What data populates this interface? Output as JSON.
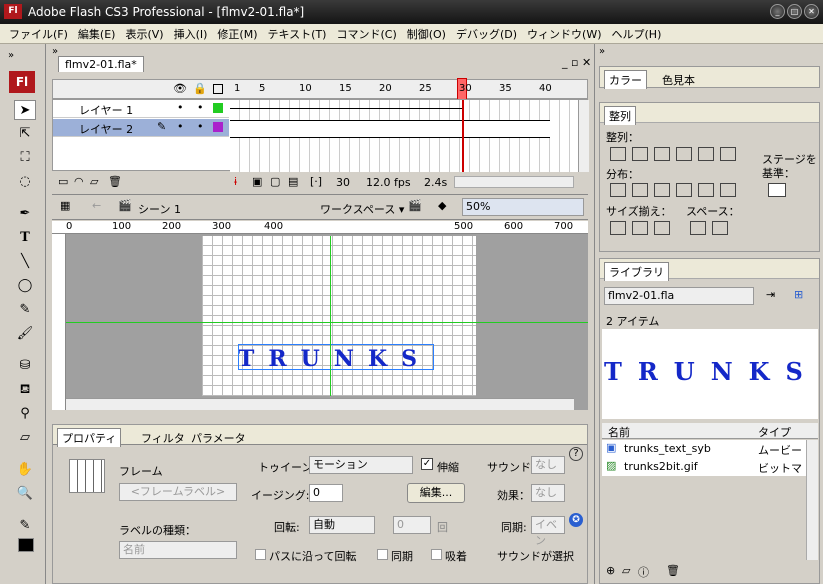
{
  "window": {
    "logo": "Fl",
    "title": "Adobe Flash CS3 Professional - [flmv2-01.fla*]",
    "min": "_",
    "max": "□",
    "close": "✕"
  },
  "menu": [
    "ファイル(F)",
    "編集(E)",
    "表示(V)",
    "挿入(I)",
    "修正(M)",
    "テキスト(T)",
    "コマンド(C)",
    "制御(O)",
    "デバッグ(D)",
    "ウィンドウ(W)",
    "ヘルプ(H)"
  ],
  "toolbox": {
    "logo": "Fl"
  },
  "document": {
    "tab": "flmv2-01.fla*"
  },
  "timeline": {
    "frame_numbers": [
      "1",
      "5",
      "10",
      "15",
      "20",
      "25",
      "30",
      "35",
      "40"
    ],
    "layers": [
      {
        "name": "レイヤー 1"
      },
      {
        "name": "レイヤー 2"
      }
    ],
    "status": {
      "frame": "30",
      "fps": "12.0 fps",
      "time": "2.4s"
    }
  },
  "editbar": {
    "scene": "シーン 1",
    "workspace": "ワークスペース ▾",
    "zoom": "50%"
  },
  "ruler": [
    "0",
    "100",
    "200",
    "300",
    "400",
    "500",
    "600",
    "700"
  ],
  "stage_text": "TRUNKS",
  "properties": {
    "tabs": [
      "プロパティ",
      "フィルタ",
      "パラメータ"
    ],
    "frame_label": "フレーム",
    "frame_label_field": "<フレームラベル>",
    "label_type_label": "ラベルの種類：",
    "label_type_value": "名前",
    "tween_label": "トゥイーン:",
    "tween_value": "モーション",
    "scale_label": "伸縮",
    "easing_label": "イージング:",
    "easing_value": "0",
    "edit_button": "編集...",
    "rotate_label": "回転:",
    "rotate_value": "自動",
    "rotate_times": "0",
    "rotate_unit": "回",
    "orient_label": "パスに沿って回転",
    "sync_label": "同期",
    "snap_label": "吸着",
    "sound_label": "サウンド:",
    "sound_value": "なし",
    "effect_label": "効果：",
    "effect_value": "なし",
    "sync_label2": "同期:",
    "sync_value": "イベン",
    "sound_note": "サウンドが選択"
  },
  "color_panel": {
    "tabs": [
      "カラー",
      "色見本"
    ]
  },
  "align_panel": {
    "tab": "整列",
    "align": "整列：",
    "distribute": "分布：",
    "match_size": "サイズ揃え：",
    "space": "スペース：",
    "stage_l1": "ステージを",
    "stage_l2": "基準："
  },
  "library": {
    "tab": "ライブラリ",
    "file": "flmv2-01.fla",
    "count": "2 アイテム",
    "preview_text": "TRUNKS",
    "col_name": "名前",
    "col_type": "タイプ",
    "items": [
      {
        "name": "trunks_text_syb",
        "type": "ムービー"
      },
      {
        "name": "trunks2bit.gif",
        "type": "ビットマ"
      }
    ]
  }
}
